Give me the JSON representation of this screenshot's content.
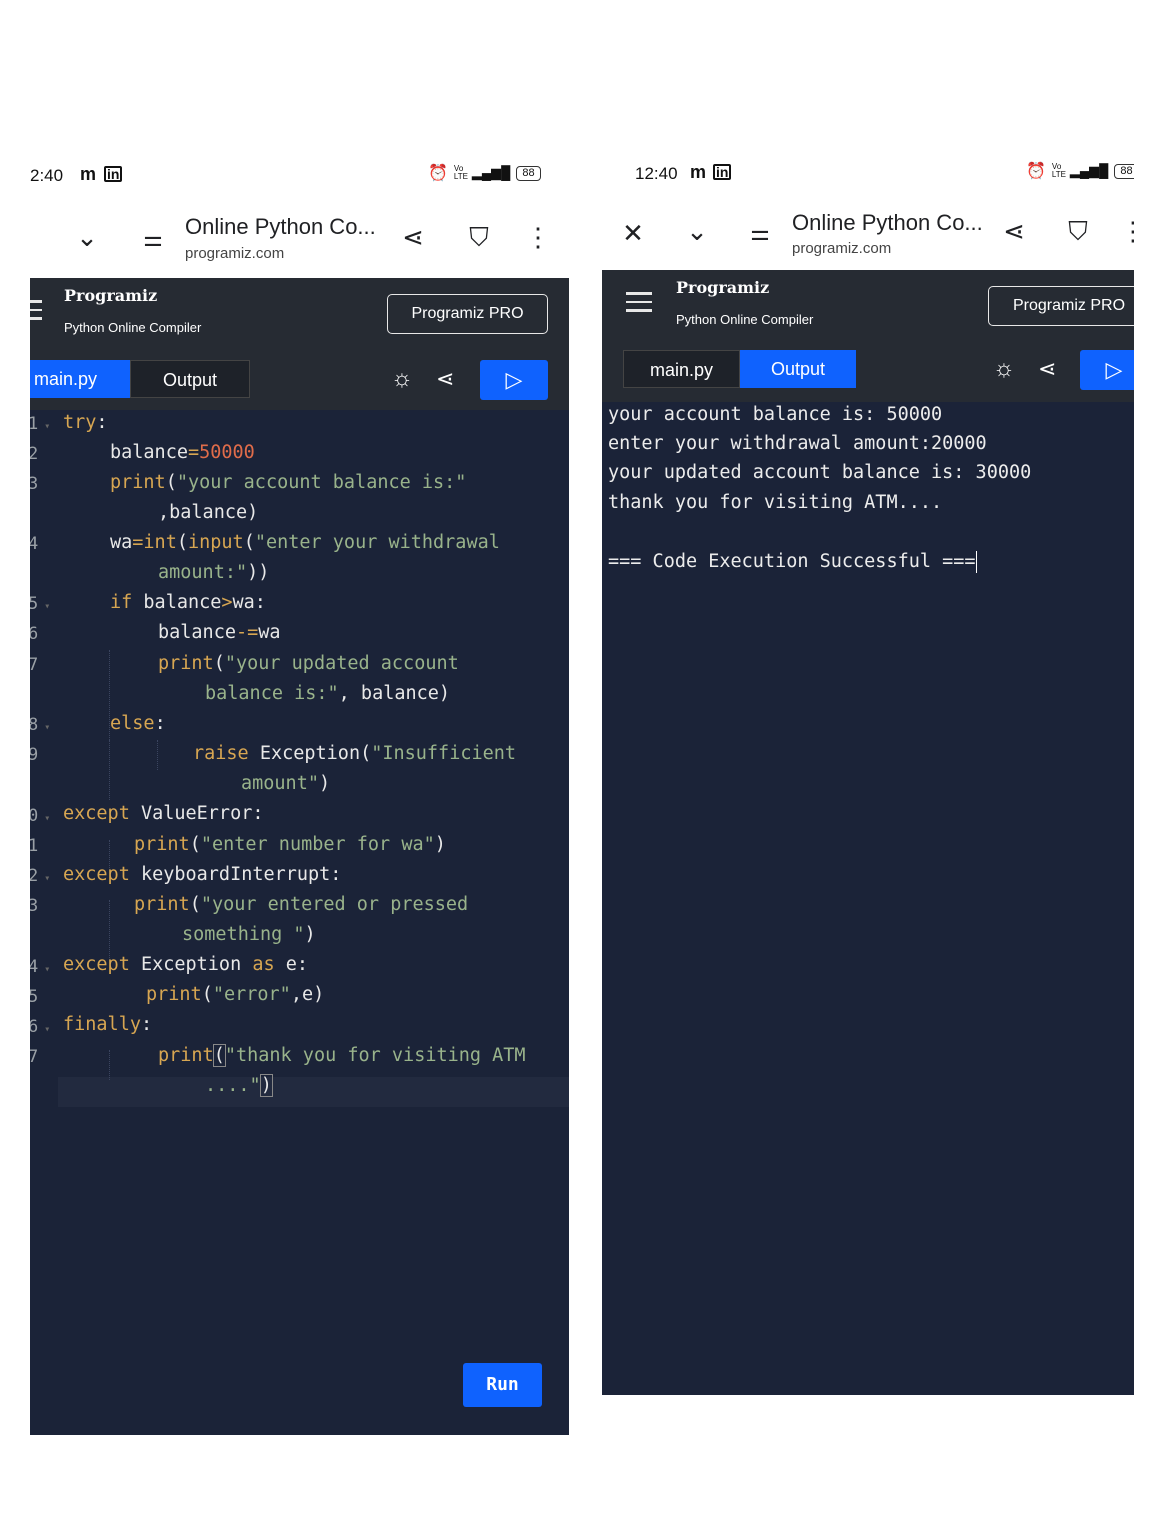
{
  "left": {
    "status": {
      "time": "2:40"
    },
    "browser": {
      "title": "Online Python Co...",
      "url": "programiz.com"
    },
    "app": {
      "logo": "Programiz",
      "subtitle": "Python Online Compiler",
      "pro_label": "Programiz PRO",
      "tabs": {
        "code": "main.py",
        "output": "Output"
      },
      "run_label": "Run"
    },
    "line_numbers": [
      "1",
      "2",
      "3",
      "4",
      "5",
      "6",
      "7",
      "8",
      "9",
      "0",
      "1",
      "2",
      "3",
      "4",
      "5",
      "6",
      "7"
    ]
  },
  "right": {
    "status": {
      "time": "12:40"
    },
    "browser": {
      "title": "Online Python Co...",
      "url": "programiz.com"
    },
    "app": {
      "logo": "Programiz",
      "subtitle": "Python Online Compiler",
      "pro_label": "Programiz PRO",
      "tabs": {
        "code": "main.py",
        "output": "Output"
      }
    },
    "output_lines": [
      "your account balance is: 50000",
      "enter your withdrawal amount:20000",
      "your updated account balance is: 30000",
      "thank you for visiting ATM....",
      "",
      "=== Code Execution Successful ==="
    ]
  },
  "status_icons": {
    "battery": "88",
    "signal": "5G",
    "volte": "Vo LTE"
  },
  "code_tokens": {
    "l1": [
      "try",
      ":"
    ],
    "l2": [
      "balance",
      "=",
      "50000"
    ],
    "l3a": [
      "print",
      "(",
      "\"your account balance is:\""
    ],
    "l3b": [
      ",balance)"
    ],
    "l4a": [
      "wa",
      "=",
      "int",
      "(",
      "input",
      "(",
      "\"enter your withdrawal"
    ],
    "l4b": [
      "amount:\"",
      "))"
    ],
    "l5": [
      "if",
      " balance",
      ">",
      "wa:"
    ],
    "l6": [
      "balance",
      "-=",
      "wa"
    ],
    "l7a": [
      "print",
      "(",
      "\"your updated account"
    ],
    "l7b": [
      "balance is:\"",
      ", balance)"
    ],
    "l8": [
      "else",
      ":"
    ],
    "l9a": [
      "raise",
      " Exception(",
      "\"Insufficient"
    ],
    "l9b": [
      "amount\"",
      ")"
    ],
    "l10": [
      "except",
      " ValueError:"
    ],
    "l11": [
      "print",
      "(",
      "\"enter number for wa\"",
      ")"
    ],
    "l12": [
      "except",
      " keyboardInterrupt:"
    ],
    "l13a": [
      "print",
      "(",
      "\"your entered or pressed"
    ],
    "l13b": [
      "something \"",
      ")"
    ],
    "l14": [
      "except",
      " Exception ",
      "as",
      " e:"
    ],
    "l15": [
      "print",
      "(",
      "\"error\"",
      ",e)"
    ],
    "l16": [
      "finally",
      ":"
    ],
    "l17a": [
      "print",
      "(",
      "\"thank you for visiting ATM"
    ],
    "l17b": [
      "....\"",
      ")"
    ]
  }
}
